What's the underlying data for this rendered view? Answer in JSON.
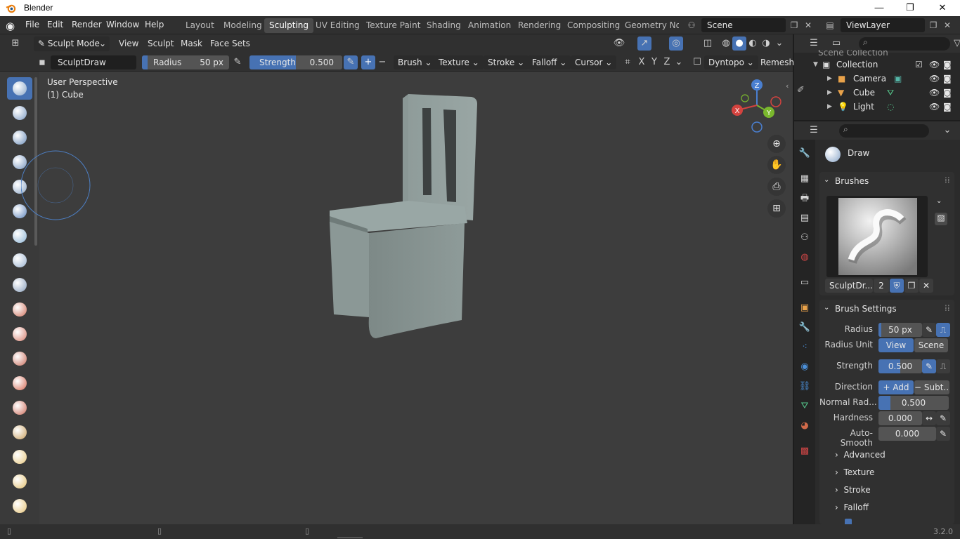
{
  "window": {
    "title": "Blender",
    "minimize": "—",
    "restore": "❐",
    "close": "✕"
  },
  "menubar": {
    "menus": [
      "File",
      "Edit",
      "Render",
      "Window",
      "Help"
    ],
    "workspaces": [
      "Layout",
      "Modeling",
      "Sculpting",
      "UV Editing",
      "Texture Paint",
      "Shading",
      "Animation",
      "Rendering",
      "Compositing",
      "Geometry Noc"
    ],
    "active_workspace": "Sculpting",
    "scene": "Scene",
    "view_layer": "ViewLayer"
  },
  "viewport_header": {
    "mode": "Sculpt Mode",
    "menus": [
      "View",
      "Sculpt",
      "Mask",
      "Face Sets"
    ]
  },
  "tool_settings": {
    "brush_name": "SculptDraw",
    "radius_label": "Radius",
    "radius_value": "50 px",
    "strength_label": "Strength",
    "strength_value": "0.500",
    "strength_fraction": 0.5,
    "plus": "+",
    "minus": "−",
    "dropdowns": [
      "Brush",
      "Texture",
      "Stroke",
      "Falloff",
      "Cursor"
    ],
    "axes": [
      "X",
      "Y",
      "Z"
    ],
    "dyntopo": "Dyntopo",
    "remesh": "Remesh"
  },
  "viewport": {
    "perspective": "User Perspective",
    "object": "(1) Cube",
    "gizmo": {
      "z": "Z",
      "y": "Y",
      "x": "X"
    }
  },
  "outliner": {
    "scene_collection": "Scene Collection",
    "collection": "Collection",
    "items": [
      {
        "name": "Camera"
      },
      {
        "name": "Cube"
      },
      {
        "name": "Light"
      }
    ]
  },
  "properties": {
    "brush_label": "Draw",
    "brushes_panel": "Brushes",
    "brush_datablock": "SculptDr...",
    "brush_users": "2",
    "brush_settings_panel": "Brush Settings",
    "radius_label": "Radius",
    "radius_value": "50 px",
    "radius_unit_label": "Radius Unit",
    "radius_unit_view": "View",
    "radius_unit_scene": "Scene",
    "strength_label": "Strength",
    "strength_value": "0.500",
    "direction_label": "Direction",
    "direction_add": "Add",
    "direction_subtract": "Subt...",
    "normal_radius_label": "Normal Rad...",
    "normal_radius_value": "0.500",
    "normal_radius_fraction": 0.17,
    "hardness_label": "Hardness",
    "hardness_value": "0.000",
    "autosmooth_label": "Auto-Smooth",
    "autosmooth_value": "0.000",
    "subpanels": [
      "Advanced",
      "Texture",
      "Stroke",
      "Falloff"
    ]
  },
  "status": {
    "version": "3.2.0"
  },
  "colors": {
    "accent": "#4772b3",
    "background": "#3d3d3d",
    "panel": "#303030"
  }
}
